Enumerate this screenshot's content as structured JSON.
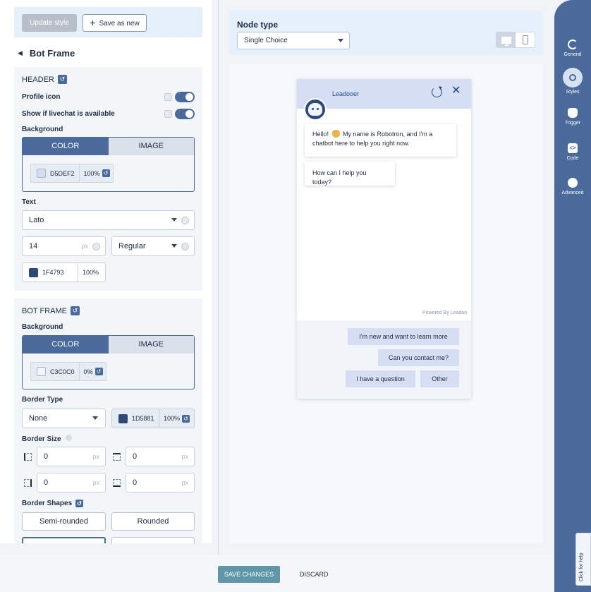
{
  "toolbar": {
    "update_label": "Update style",
    "saveas_label": "Save as new"
  },
  "panel": {
    "title": "Bot Frame"
  },
  "header_section": {
    "title": "HEADER",
    "profile_icon_label": "Profile icon",
    "livechat_label": "Show if livechat is available",
    "background_label": "Background",
    "tab_color": "COLOR",
    "tab_image": "IMAGE",
    "bg_hex": "D5DEF2",
    "bg_opacity": "100%",
    "text_label": "Text",
    "font_family": "Lato",
    "font_size": "14",
    "font_unit": "px",
    "font_weight": "Regular",
    "text_hex": "1F4793",
    "text_opacity": "100%"
  },
  "botframe_section": {
    "title": "BOT FRAME",
    "background_label": "Background",
    "tab_color": "COLOR",
    "tab_image": "IMAGE",
    "bg_hex": "C3C0C0",
    "bg_opacity": "0%",
    "border_type_label": "Border Type",
    "border_type": "None",
    "border_hex": "1D5881",
    "border_opacity": "100%",
    "border_size_label": "Border Size",
    "border_top": "0",
    "border_right": "0",
    "border_bottom": "0",
    "border_left": "0",
    "unit": "px",
    "border_shapes_label": "Border Shapes",
    "shape_semi": "Semi-rounded",
    "shape_rounded": "Rounded"
  },
  "node": {
    "label": "Node type",
    "value": "Single Choice"
  },
  "chat": {
    "bot_name": "Leadooer",
    "message_1a": "Hello! ",
    "message_1b": " My name is Robotron, and I'm a chatbot here to help you right now.",
    "message_2": "How can I help you today?",
    "powered": "Powered By Leadoo",
    "choices": [
      "I'm new and want to learn more",
      "Can you contact me?",
      "I have a question",
      "Other"
    ]
  },
  "rail": {
    "general": "General",
    "styles": "Styles",
    "trigger": "Trigger",
    "code": "Code",
    "advanced": "Advanced",
    "help": "Click for help"
  },
  "footer": {
    "save": "SAVE CHANGES",
    "discard": "DISCARD"
  },
  "colors": {
    "accent": "#4A6A9B",
    "header_bg": "#D5DEF2",
    "text": "#1F4793",
    "border": "#1D5881",
    "frame_bg": "#C3C0C0"
  }
}
